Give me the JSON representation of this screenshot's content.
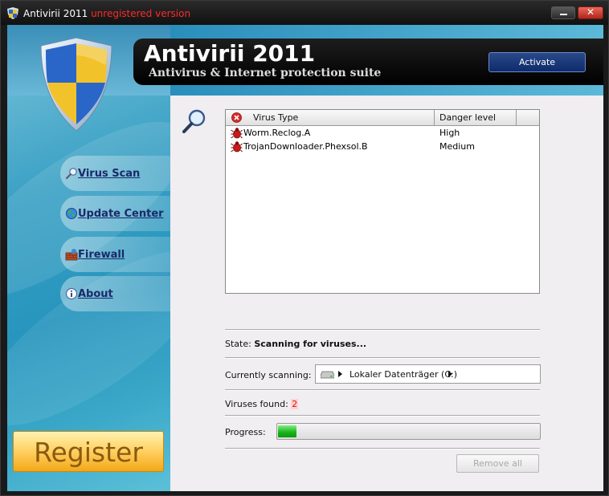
{
  "window": {
    "app_name": "Antivirii 2011",
    "unregistered_label": "unregistered version",
    "minimize_label": "",
    "close_label": "✕"
  },
  "header": {
    "title": "Antivirii 2011",
    "subtitle": "Antivirus & Internet protection suite",
    "activate_label": "Activate"
  },
  "sidebar": {
    "items": [
      {
        "label": "Virus Scan",
        "icon": "magnifier-icon"
      },
      {
        "label": "Update Center",
        "icon": "globe-icon"
      },
      {
        "label": "Firewall",
        "icon": "brick-wall-icon"
      },
      {
        "label": "About",
        "icon": "info-icon"
      }
    ],
    "register_label": "Register"
  },
  "scan": {
    "columns": [
      "Virus Type",
      "Danger level"
    ],
    "rows": [
      {
        "name": "Worm.Reclog.A",
        "danger": "High"
      },
      {
        "name": "TrojanDownloader.Phexsol.B",
        "danger": "Medium"
      }
    ],
    "state_label": "State:",
    "state_value": "Scanning for viruses...",
    "currently_scanning_label": "Currently scanning:",
    "currently_scanning_value": "Lokaler Datenträger (C:)",
    "viruses_found_label": "Viruses found:",
    "viruses_found_value": "2",
    "progress_label": "Progress:",
    "progress_fraction": 0.07,
    "remove_all_label": "Remove all"
  },
  "colors": {
    "accent_blue": "#2795bd",
    "danger_red": "#e01010",
    "register_orange": "#ffd060",
    "progress_green": "#18b018"
  }
}
